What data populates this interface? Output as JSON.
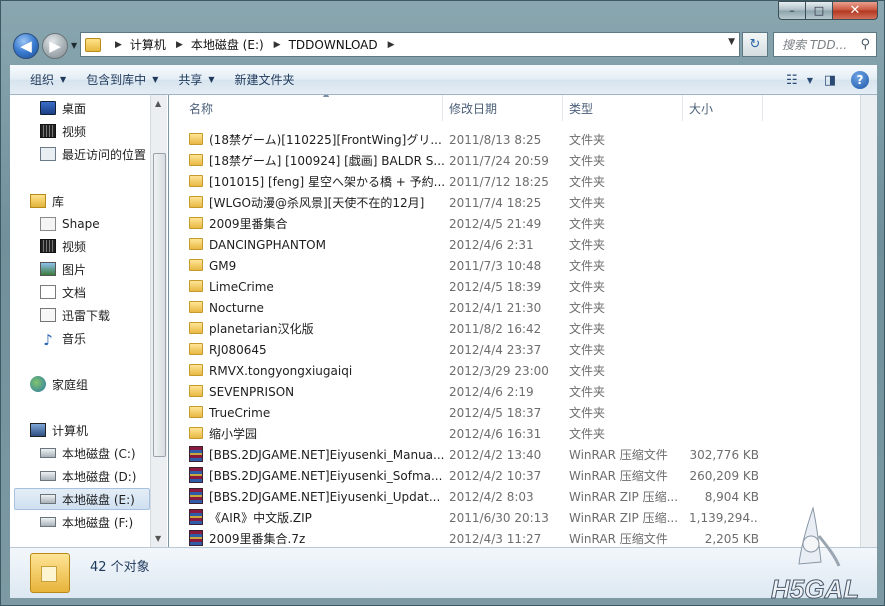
{
  "window": {
    "caption": {
      "min": "–",
      "max": "□",
      "close": "✕"
    }
  },
  "address": {
    "segments": [
      "计算机",
      "本地磁盘 (E:)",
      "TDDOWNLOAD"
    ],
    "search_placeholder": "搜索 TDD..."
  },
  "toolbar": {
    "organize": "组织",
    "include": "包含到库中",
    "share": "共享",
    "new_folder": "新建文件夹"
  },
  "sidebar": {
    "favorites": [
      "桌面",
      "视频",
      "最近访问的位置"
    ],
    "library_header": "库",
    "libraries": [
      "Shape",
      "视频",
      "图片",
      "文档",
      "迅雷下载",
      "音乐"
    ],
    "homegroup": "家庭组",
    "computer_header": "计算机",
    "drives": [
      "本地磁盘 (C:)",
      "本地磁盘 (D:)",
      "本地磁盘 (E:)",
      "本地磁盘 (F:)"
    ],
    "selected": "本地磁盘 (E:)"
  },
  "columns": {
    "name": "名称",
    "date": "修改日期",
    "type": "类型",
    "size": "大小"
  },
  "files": [
    {
      "icon": "folder-icon",
      "name": "(18禁ゲーム)[110225][FrontWing]グリ...",
      "date": "2011/8/13 8:25",
      "type": "文件夹",
      "size": ""
    },
    {
      "icon": "folder-icon",
      "name": "[18禁ゲーム] [100924] [戯画] BALDR S...",
      "date": "2011/7/24 20:59",
      "type": "文件夹",
      "size": ""
    },
    {
      "icon": "folder-icon",
      "name": "[101015] [feng] 星空へ架かる橋 + 予約...",
      "date": "2011/7/12 18:25",
      "type": "文件夹",
      "size": ""
    },
    {
      "icon": "folder-icon",
      "name": "[WLGO动漫@杀风景][天使不在的12月]",
      "date": "2011/7/4 18:25",
      "type": "文件夹",
      "size": ""
    },
    {
      "icon": "folder-icon",
      "name": "2009里番集合",
      "date": "2012/4/5 21:49",
      "type": "文件夹",
      "size": ""
    },
    {
      "icon": "folder-icon",
      "name": "DANCINGPHANTOM",
      "date": "2012/4/6 2:31",
      "type": "文件夹",
      "size": ""
    },
    {
      "icon": "folder-icon",
      "name": "GM9",
      "date": "2011/7/3 10:48",
      "type": "文件夹",
      "size": ""
    },
    {
      "icon": "folder-icon",
      "name": "LimeCrime",
      "date": "2012/4/5 18:39",
      "type": "文件夹",
      "size": ""
    },
    {
      "icon": "folder-icon",
      "name": "Nocturne",
      "date": "2012/4/1 21:30",
      "type": "文件夹",
      "size": ""
    },
    {
      "icon": "folder-icon",
      "name": "planetarian汉化版",
      "date": "2011/8/2 16:42",
      "type": "文件夹",
      "size": ""
    },
    {
      "icon": "folder-icon",
      "name": "RJ080645",
      "date": "2012/4/4 23:37",
      "type": "文件夹",
      "size": ""
    },
    {
      "icon": "folder-icon",
      "name": "RMVX.tongyongxiugaiqi",
      "date": "2012/3/29 23:00",
      "type": "文件夹",
      "size": ""
    },
    {
      "icon": "folder-icon",
      "name": "SEVENPRISON",
      "date": "2012/4/6 2:19",
      "type": "文件夹",
      "size": ""
    },
    {
      "icon": "folder-icon",
      "name": "TrueCrime",
      "date": "2012/4/5 18:37",
      "type": "文件夹",
      "size": ""
    },
    {
      "icon": "folder-icon",
      "name": "缩小学园",
      "date": "2012/4/6 16:31",
      "type": "文件夹",
      "size": ""
    },
    {
      "icon": "winrar-icon",
      "name": "[BBS.2DJGAME.NET]Eiyusenki_Manua...",
      "date": "2012/4/2 13:40",
      "type": "WinRAR 压缩文件",
      "size": "302,776 KB"
    },
    {
      "icon": "winrar-icon",
      "name": "[BBS.2DJGAME.NET]Eiyusenki_Sofma...",
      "date": "2012/4/2 10:37",
      "type": "WinRAR 压缩文件",
      "size": "260,209 KB"
    },
    {
      "icon": "winrar-icon",
      "name": "[BBS.2DJGAME.NET]Eiyusenki_Updat...",
      "date": "2012/4/2 8:03",
      "type": "WinRAR ZIP 压缩...",
      "size": "8,904 KB"
    },
    {
      "icon": "winrar-icon",
      "name": "《AIR》中文版.ZIP",
      "date": "2011/6/30 20:13",
      "type": "WinRAR ZIP 压缩...",
      "size": "1,139,294..."
    },
    {
      "icon": "winrar-icon",
      "name": "2009里番集合.7z",
      "date": "2012/4/3 11:27",
      "type": "WinRAR 压缩文件",
      "size": "2,205 KB"
    }
  ],
  "status": {
    "count": "42 个对象"
  },
  "watermark": {
    "text": "H5GAL"
  }
}
